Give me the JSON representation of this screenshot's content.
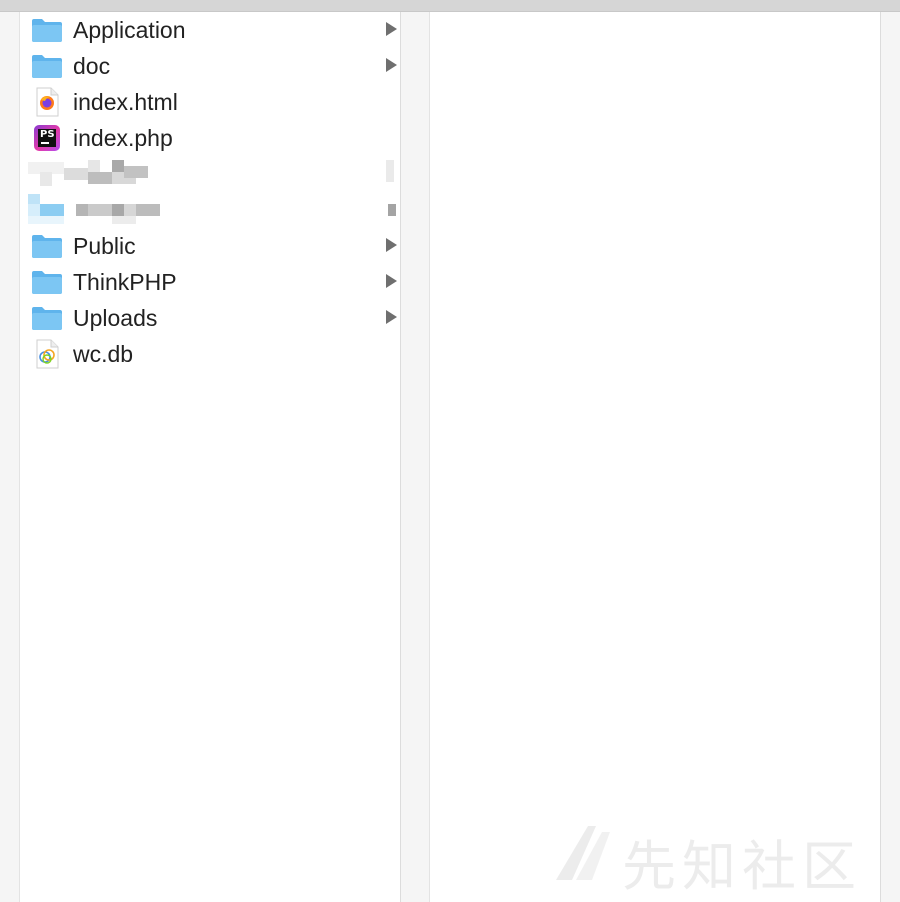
{
  "finder": {
    "items": [
      {
        "label": "Application",
        "icon": "folder-icon",
        "has_children": true
      },
      {
        "label": "doc",
        "icon": "folder-icon",
        "has_children": true
      },
      {
        "label": "index.html",
        "icon": "firefox-html-file-icon",
        "has_children": false
      },
      {
        "label": "index.php",
        "icon": "phpstorm-file-icon",
        "has_children": false
      },
      {
        "label": "",
        "icon": "redacted-file-icon",
        "has_children": true
      },
      {
        "label": "",
        "icon": "redacted-folder-icon",
        "has_children": true
      },
      {
        "label": "Public",
        "icon": "folder-icon",
        "has_children": true
      },
      {
        "label": "ThinkPHP",
        "icon": "folder-icon",
        "has_children": true
      },
      {
        "label": "Uploads",
        "icon": "folder-icon",
        "has_children": true
      },
      {
        "label": "wc.db",
        "icon": "database-file-icon",
        "has_children": false
      }
    ]
  },
  "watermark": {
    "text": "先知社区"
  },
  "colors": {
    "folder": "#7cc6f3",
    "folder_tab": "#5fb4ec",
    "chevron": "#6f6f6f",
    "text": "#222222"
  }
}
